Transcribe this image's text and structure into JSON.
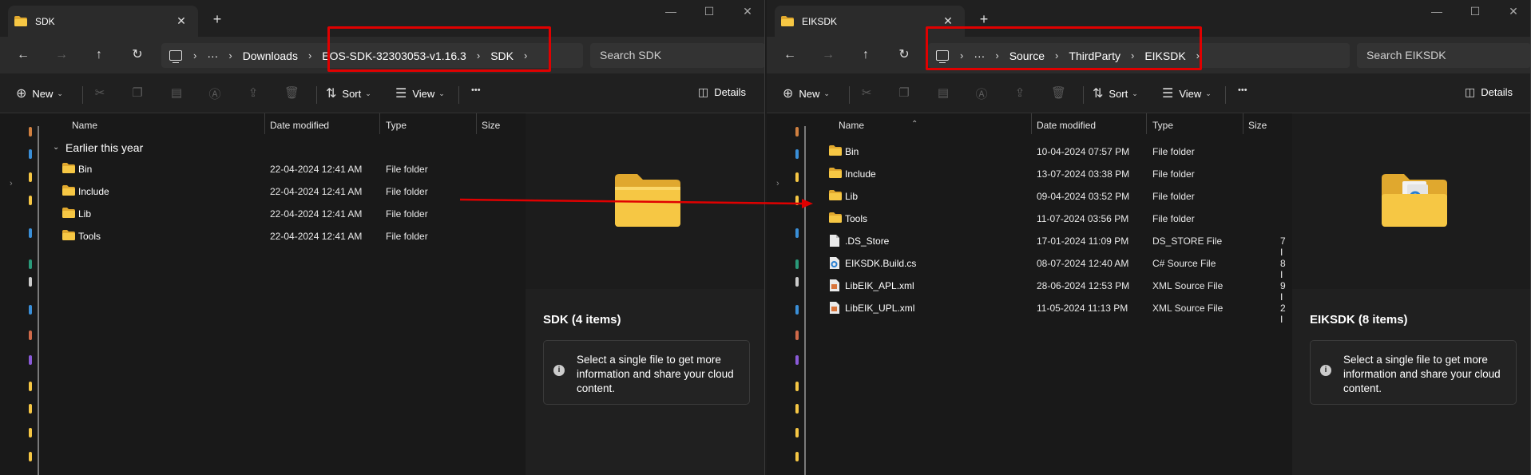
{
  "colors": {
    "folder": "#f6c744",
    "folder_dark": "#e0a82e",
    "annotation": "#e00000"
  },
  "left": {
    "tab_title": "SDK",
    "tab_close": "✕",
    "new_tab": "+",
    "window_controls": [
      "—",
      "☐",
      "✕"
    ],
    "breadcrumb": {
      "more": "···",
      "items": [
        "Downloads",
        "EOS-SDK-32303053-v1.16.3",
        "SDK"
      ]
    },
    "search_placeholder": "Search SDK",
    "commands": {
      "new": "New",
      "sort": "Sort",
      "view": "View",
      "more": "•••",
      "details": "Details"
    },
    "columns": [
      "Name",
      "Date modified",
      "Type",
      "Size"
    ],
    "group": "Earlier this year",
    "rows": [
      {
        "name": "Bin",
        "date": "22-04-2024 12:41 AM",
        "type": "File folder",
        "size": "",
        "icon": "folder-icon"
      },
      {
        "name": "Include",
        "date": "22-04-2024 12:41 AM",
        "type": "File folder",
        "size": "",
        "icon": "folder-icon"
      },
      {
        "name": "Lib",
        "date": "22-04-2024 12:41 AM",
        "type": "File folder",
        "size": "",
        "icon": "folder-icon"
      },
      {
        "name": "Tools",
        "date": "22-04-2024 12:41 AM",
        "type": "File folder",
        "size": "",
        "icon": "folder-icon"
      }
    ],
    "details_title": "SDK (4 items)",
    "details_info": "Select a single file to get more information and share your cloud content."
  },
  "right": {
    "tab_title": "EIKSDK",
    "tab_close": "✕",
    "new_tab": "+",
    "window_controls": [
      "—",
      "☐",
      "✕"
    ],
    "breadcrumb": {
      "more": "···",
      "items": [
        "Source",
        "ThirdParty",
        "EIKSDK"
      ]
    },
    "search_placeholder": "Search EIKSDK",
    "commands": {
      "new": "New",
      "sort": "Sort",
      "view": "View",
      "more": "•••",
      "details": "Details"
    },
    "columns": [
      "Name",
      "Date modified",
      "Type",
      "Size"
    ],
    "rows": [
      {
        "name": "Bin",
        "date": "10-04-2024 07:57 PM",
        "type": "File folder",
        "size": "",
        "icon": "folder-icon"
      },
      {
        "name": "Include",
        "date": "13-07-2024 03:38 PM",
        "type": "File folder",
        "size": "",
        "icon": "folder-icon"
      },
      {
        "name": "Lib",
        "date": "09-04-2024 03:52 PM",
        "type": "File folder",
        "size": "",
        "icon": "folder-icon"
      },
      {
        "name": "Tools",
        "date": "11-07-2024 03:56 PM",
        "type": "File folder",
        "size": "",
        "icon": "folder-icon"
      },
      {
        "name": ".DS_Store",
        "date": "17-01-2024 11:09 PM",
        "type": "DS_STORE File",
        "size": "7 I",
        "icon": "file-icon"
      },
      {
        "name": "EIKSDK.Build.cs",
        "date": "08-07-2024 12:40 AM",
        "type": "C# Source File",
        "size": "8 I",
        "icon": "cs-file-icon"
      },
      {
        "name": "LibEIK_APL.xml",
        "date": "28-06-2024 12:53 PM",
        "type": "XML Source File",
        "size": "9 I",
        "icon": "xml-file-icon"
      },
      {
        "name": "LibEIK_UPL.xml",
        "date": "11-05-2024 11:13 PM",
        "type": "XML Source File",
        "size": "2 I",
        "icon": "xml-file-icon"
      }
    ],
    "details_title": "EIKSDK (8 items)",
    "details_info": "Select a single file to get more information and share your cloud content."
  }
}
